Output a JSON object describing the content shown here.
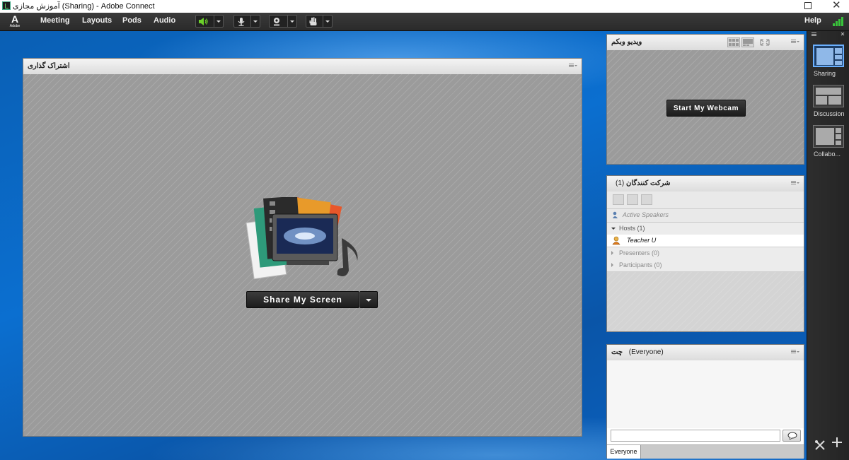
{
  "window": {
    "title": "آموزش مجازی (Sharing) - Adobe Connect"
  },
  "menubar": {
    "logo_text": "A",
    "logo_subtext": "Adobe",
    "items": [
      {
        "label": "Meeting"
      },
      {
        "label": "Layouts"
      },
      {
        "label": "Pods"
      },
      {
        "label": "Audio"
      }
    ],
    "help_label": "Help",
    "toolbar_icons": [
      "speaker-icon",
      "microphone-icon",
      "webcam-icon",
      "raise-hand-icon"
    ],
    "speaker_color": "#6cd12a"
  },
  "share_pod": {
    "title": "اشتراک گذاری",
    "button_label": "Share My Screen"
  },
  "video_pod": {
    "title": "ویدیو وبکم",
    "button_label": "Start My Webcam"
  },
  "attendees_pod": {
    "title": "شرکت کنندگان",
    "count": "(1)",
    "active_speakers": "Active Speakers",
    "groups": [
      {
        "label": "Hosts (1)",
        "expanded": true
      },
      {
        "label": "Presenters (0)",
        "expanded": false
      },
      {
        "label": "Participants (0)",
        "expanded": false
      }
    ],
    "host_name": "Teacher U"
  },
  "chat_pod": {
    "title": "چت",
    "audience": "(Everyone)",
    "tab_label": "Everyone",
    "input_value": ""
  },
  "layouts": [
    {
      "label": "Sharing",
      "selected": true
    },
    {
      "label": "Discussion",
      "selected": false
    },
    {
      "label": "Collabo...",
      "selected": false
    }
  ],
  "colors": {
    "desktop_blue": "#0b6fd0",
    "selected_layout": "#6ab0ff",
    "pod_hatch": "#9b9b9b"
  }
}
